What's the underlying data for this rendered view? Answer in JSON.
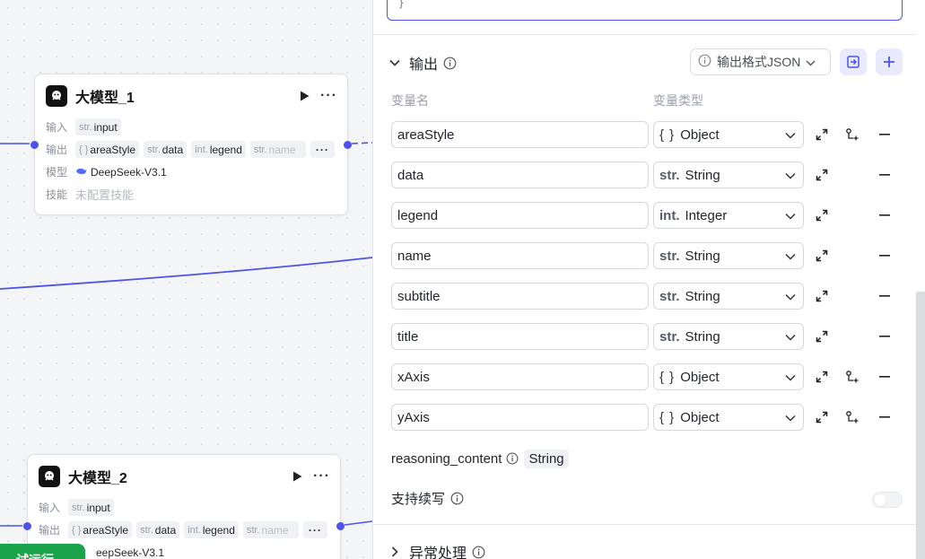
{
  "canvas": {
    "nodes": [
      {
        "title": "大模型_1",
        "input_label": "输入",
        "input_tag": {
          "type": "str.",
          "name": "input"
        },
        "output_label": "输出",
        "output_tags": [
          {
            "type": "{ }",
            "name": "areaStyle"
          },
          {
            "type": "str.",
            "name": "data"
          },
          {
            "type": "int.",
            "name": "legend"
          },
          {
            "type": "str.",
            "name": "name"
          }
        ],
        "more": "···",
        "model_label": "模型",
        "model_name": "DeepSeek-V3.1",
        "skill_label": "技能",
        "skill_value": "未配置技能"
      },
      {
        "title": "大模型_2",
        "input_label": "输入",
        "input_tag": {
          "type": "str.",
          "name": "input"
        },
        "output_label": "输出",
        "output_tags": [
          {
            "type": "{ }",
            "name": "areaStyle"
          },
          {
            "type": "str.",
            "name": "data"
          },
          {
            "type": "int.",
            "name": "legend"
          },
          {
            "type": "str.",
            "name": "name"
          }
        ],
        "more": "···",
        "model_name_partial": "eepSeek-V3.1"
      }
    ],
    "run_button_partial": "试运行"
  },
  "panel": {
    "code_tail": "}",
    "output_section": {
      "title": "输出",
      "format_button": "输出格式JSON",
      "col_name": "变量名",
      "col_type": "变量类型",
      "variables": [
        {
          "name": "areaStyle",
          "type_tag": "{ }",
          "type": "Object",
          "has_child": true
        },
        {
          "name": "data",
          "type_tag": "str.",
          "type": "String",
          "has_child": false
        },
        {
          "name": "legend",
          "type_tag": "int.",
          "type": "Integer",
          "has_child": false
        },
        {
          "name": "name",
          "type_tag": "str.",
          "type": "String",
          "has_child": false
        },
        {
          "name": "subtitle",
          "type_tag": "str.",
          "type": "String",
          "has_child": false
        },
        {
          "name": "title",
          "type_tag": "str.",
          "type": "String",
          "has_child": false
        },
        {
          "name": "xAxis",
          "type_tag": "{ }",
          "type": "Object",
          "has_child": true
        },
        {
          "name": "yAxis",
          "type_tag": "{ }",
          "type": "Object",
          "has_child": true
        }
      ],
      "reasoning_label": "reasoning_content",
      "reasoning_type": "String",
      "continue_label": "支持续写",
      "continue_enabled": false
    },
    "error_section": {
      "title": "异常处理"
    }
  },
  "colors": {
    "accent": "#4d53e8",
    "run_green": "#1aa34a"
  }
}
